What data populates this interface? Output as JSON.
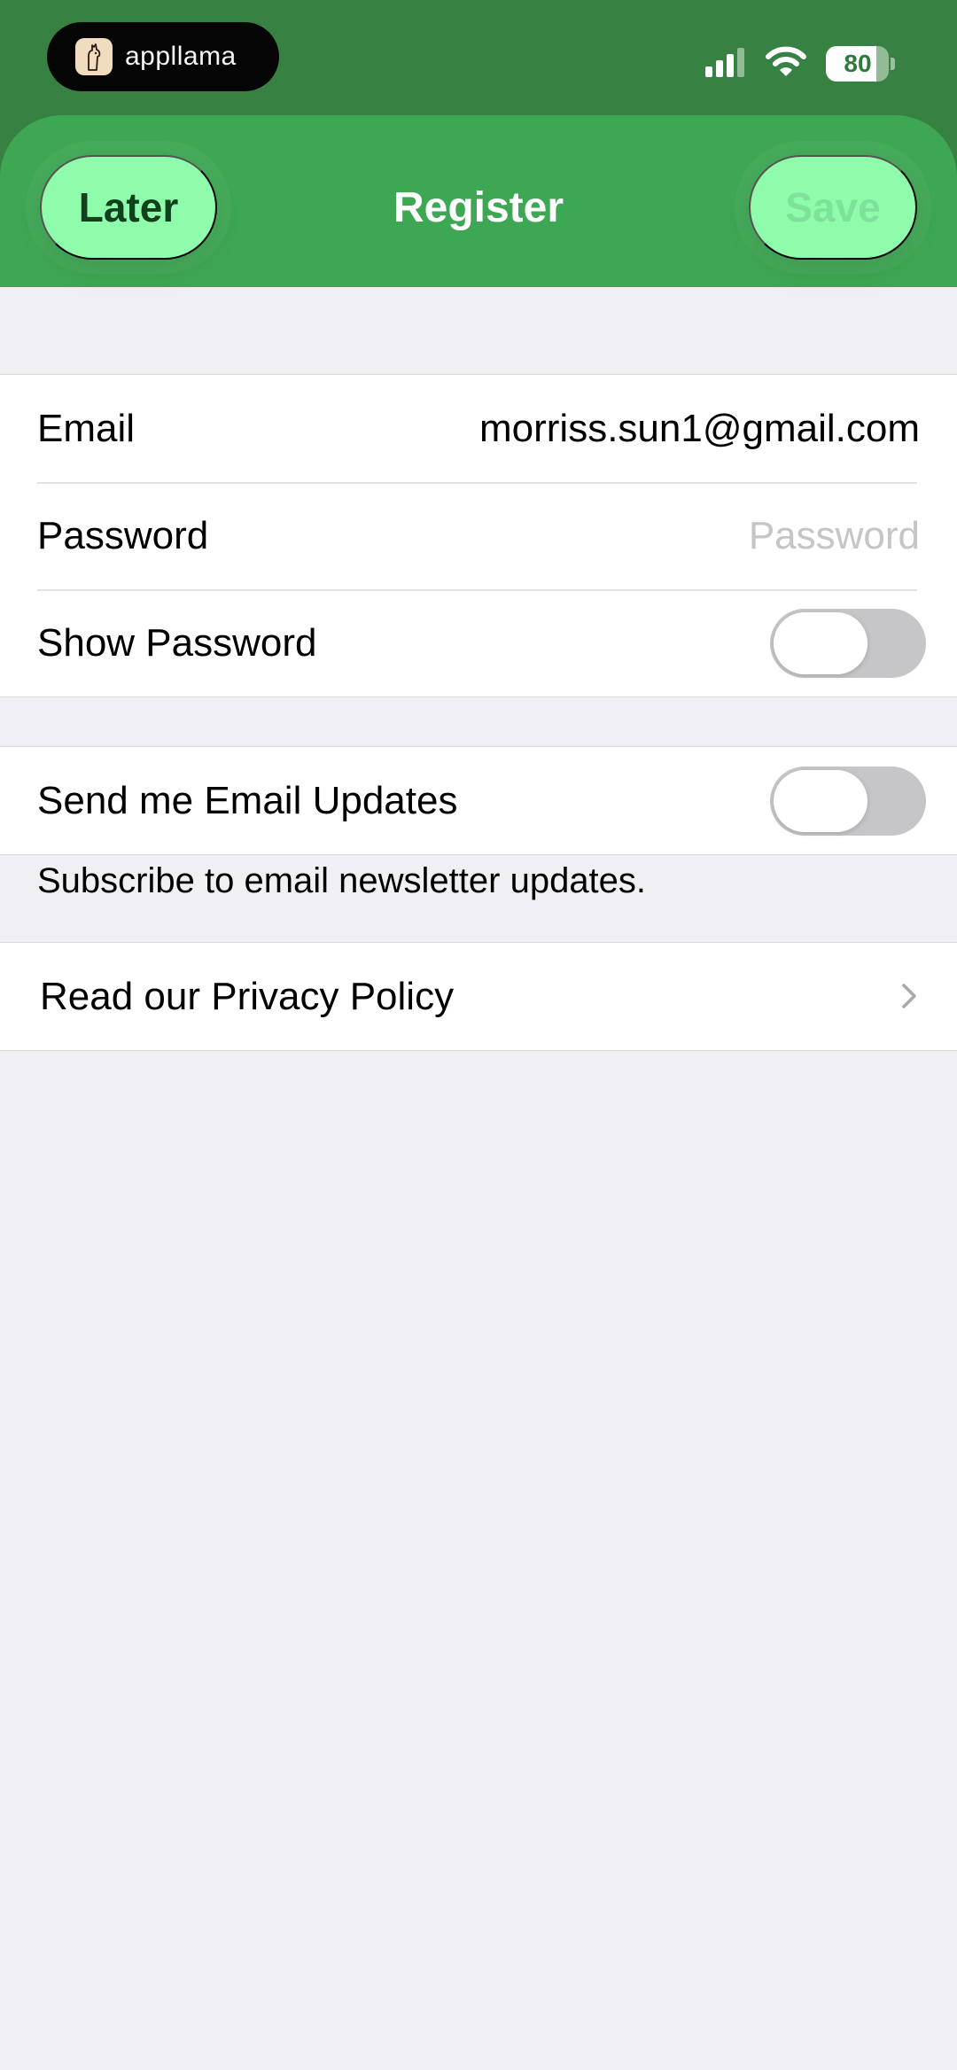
{
  "status_bar": {
    "app_name": "appllama",
    "battery_level": "80",
    "battery_fraction": 0.8
  },
  "nav": {
    "left_button": "Later",
    "title": "Register",
    "right_button": "Save"
  },
  "form": {
    "email_label": "Email",
    "email_value": "morriss.sun1@gmail.com",
    "password_label": "Password",
    "password_placeholder": "Password",
    "show_password_label": "Show Password",
    "show_password_on": false
  },
  "updates": {
    "label": "Send me Email Updates",
    "on": false,
    "footnote": "Subscribe to email newsletter updates."
  },
  "privacy": {
    "label": "Read our Privacy Policy"
  },
  "colors": {
    "status_bar": "#378143",
    "nav_bar": "#3ea753",
    "nav_button": "#8ffcab",
    "background": "#efeff4"
  }
}
